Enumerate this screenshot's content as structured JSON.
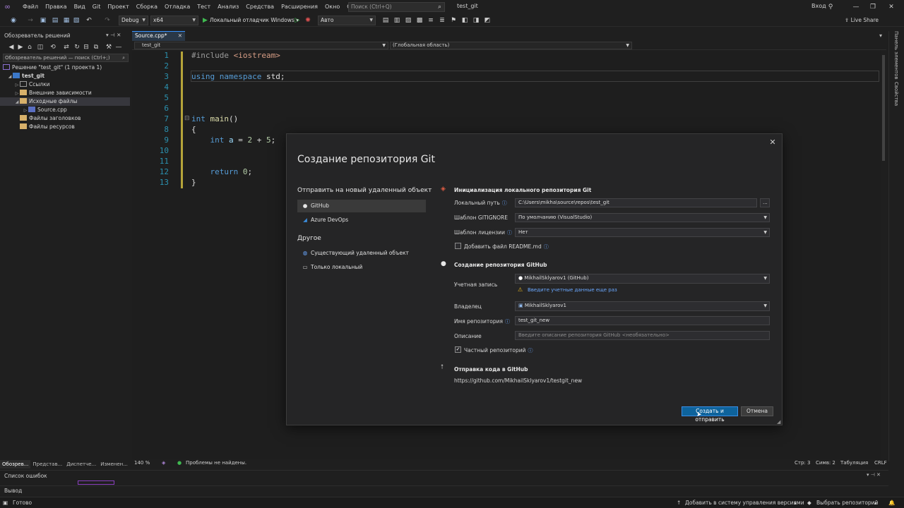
{
  "menubar": {
    "items": [
      "Файл",
      "Правка",
      "Вид",
      "Git",
      "Проект",
      "Сборка",
      "Отладка",
      "Тест",
      "Анализ",
      "Средства",
      "Расширения",
      "Окно",
      "Справка"
    ],
    "search_placeholder": "Поиск (Ctrl+Q)",
    "solution_name": "test_git",
    "signin": "Вход"
  },
  "toolbar": {
    "config": "Debug",
    "platform": "x64",
    "debugger": "Локальный отладчик Windows",
    "auto": "Авто",
    "live_share": "Live Share"
  },
  "solution_explorer": {
    "title": "Обозреватель решений",
    "search": "Обозреватель решений — поиск (Ctrl+;)",
    "tree": [
      {
        "label": "Решение \"test_git\" (1 проекта 1)",
        "twisty": ""
      },
      {
        "label": "test_git",
        "twisty": "◢"
      },
      {
        "label": "Ссылки",
        "twisty": "▷"
      },
      {
        "label": "Внешние зависимости",
        "twisty": "▷"
      },
      {
        "label": "Исходные файлы",
        "twisty": "◢"
      },
      {
        "label": "Source.cpp",
        "twisty": "▷"
      },
      {
        "label": "Файлы заголовков",
        "twisty": ""
      },
      {
        "label": "Файлы ресурсов",
        "twisty": ""
      }
    ],
    "tabs": [
      "Обозрев...",
      "Предстaв...",
      "Диспетче...",
      "Изменен..."
    ]
  },
  "editor": {
    "tab": "Source.cpp*",
    "nav_project": "test_git",
    "nav_scope": "(Глобальная область)",
    "line_numbers": [
      "1",
      "2",
      "3",
      "4",
      "5",
      "6",
      "7",
      "8",
      "9",
      "10",
      "11",
      "12",
      "13"
    ],
    "zoom": "140 %",
    "problems": "Проблемы не найдены.",
    "position": {
      "line": "Стр: 3",
      "col": "Симв: 2",
      "tabs": "Табуляция",
      "eol": "CRLF"
    }
  },
  "right_rail": {
    "toolbox": "Панель элементов",
    "properties": "Свойства"
  },
  "bottom": {
    "errors_title": "Список ошибок",
    "output_title": "Вывод"
  },
  "status": {
    "ready": "Готово",
    "add_scc": "Добавить в систему управления версиями",
    "select_repo": "Выбрать репозиторий"
  },
  "dialog": {
    "title": "Создание репозитория Git",
    "push_heading": "Отправить на новый удаленный объект",
    "github": "GitHub",
    "azure": "Azure DevOps",
    "other_heading": "Другое",
    "existing_remote": "Существующий удаленный объект",
    "local_only": "Только локальный",
    "init_heading": "Инициализация локального репозитория Git",
    "local_path_label": "Локальный путь",
    "local_path_value": "C:\\Users\\mikha\\source\\repos\\test_git",
    "browse": "...",
    "gitignore_label": "Шаблон GITIGNORE",
    "gitignore_value": "По умолчанию (VisualStudio)",
    "license_label": "Шаблон лицензии",
    "license_value": "Нет",
    "readme_label": "Добавить файл README.md",
    "github_heading": "Создание репозитория GitHub",
    "account_label": "Учетная запись",
    "account_value": "MikhailSklyarov1 (GitHub)",
    "account_warning": "Введите учетные данные еще раз",
    "owner_label": "Владелец",
    "owner_value": "MikhailSklyarov1",
    "repo_name_label": "Имя репозитория",
    "repo_name_value": "test_git_new",
    "description_label": "Описание",
    "description_placeholder": "Введите описание репозитория GitHub <необязательно>",
    "private_label": "Частный репозиторий",
    "push_code_heading": "Отправка кода в GitHub",
    "push_url": "https://github.com/MikhailSklyarov1/testgit_new",
    "create_button": "Создать и отправить",
    "cancel_button": "Отмена"
  }
}
